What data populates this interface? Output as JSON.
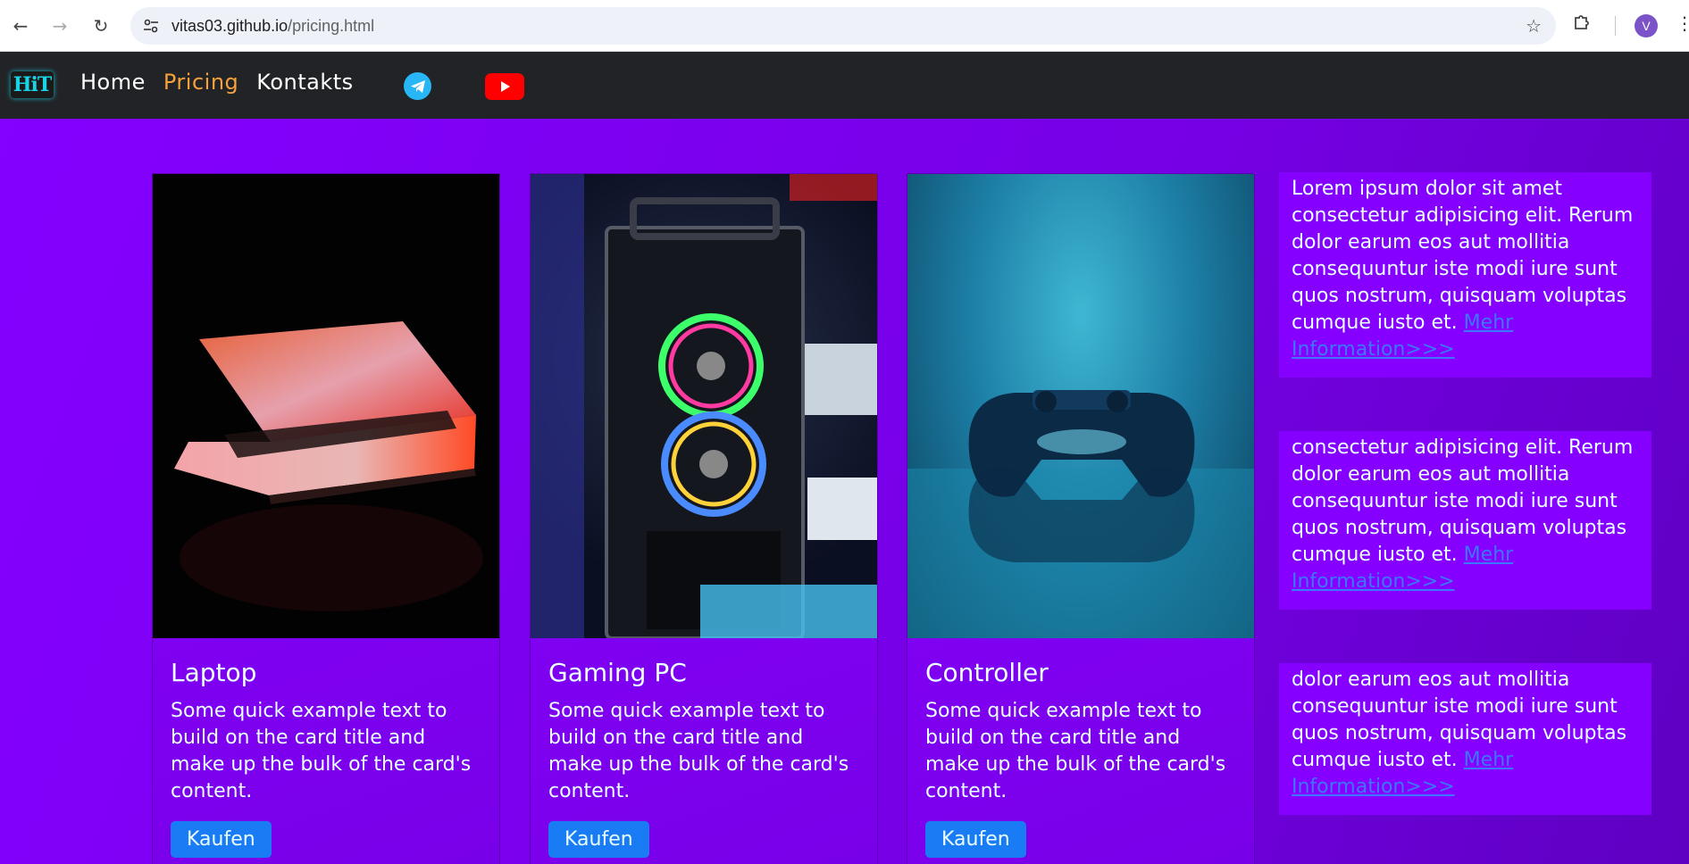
{
  "browser": {
    "url_host": "vitas03.github.io",
    "url_path": "/pricing.html",
    "avatar_letter": "V",
    "icons": [
      "back-arrow-icon",
      "forward-arrow-icon",
      "reload-icon",
      "site-settings-icon",
      "star-icon",
      "extensions-icon",
      "menu-dots-icon"
    ]
  },
  "header": {
    "logo_text": "HiT",
    "nav": [
      {
        "label": "Home",
        "active": false
      },
      {
        "label": "Pricing",
        "active": true
      },
      {
        "label": "Kontakts",
        "active": false
      }
    ],
    "social": [
      "telegram-icon",
      "youtube-icon"
    ],
    "colors": {
      "background": "#222326",
      "active_link": "#f4a23b"
    }
  },
  "cards": [
    {
      "title": "Laptop",
      "text": "Some quick example text to build on the card title and make up the bulk of the card's content.",
      "button": "Kaufen"
    },
    {
      "title": "Gaming PC",
      "text": "Some quick example text to build on the card title and make up the bulk of the card's content.",
      "button": "Kaufen"
    },
    {
      "title": "Controller",
      "text": "Some quick example text to build on the card title and make up the bulk of the card's content.",
      "button": "Kaufen"
    }
  ],
  "info_blocks": [
    {
      "text": "Lorem ipsum dolor sit amet consectetur adipisicing elit. Rerum dolor earum eos aut mollitia consequuntur iste modi iure sunt quos nostrum, quisquam voluptas cumque iusto et.",
      "link": "Mehr Information>>>"
    },
    {
      "text": "consectetur adipisicing elit. Rerum dolor earum eos aut mollitia consequuntur iste modi iure sunt quos nostrum, quisquam voluptas cumque iusto et.",
      "link": "Mehr Information>>>"
    },
    {
      "text": "dolor earum eos aut mollitia consequuntur iste modi iure sunt quos nostrum, quisquam voluptas cumque iusto et.",
      "link": "Mehr Information>>>"
    }
  ],
  "theme": {
    "page_background": "#8400ff",
    "text": "#eaffff",
    "button": "#1a7cf5",
    "link": "#3b78ff"
  }
}
